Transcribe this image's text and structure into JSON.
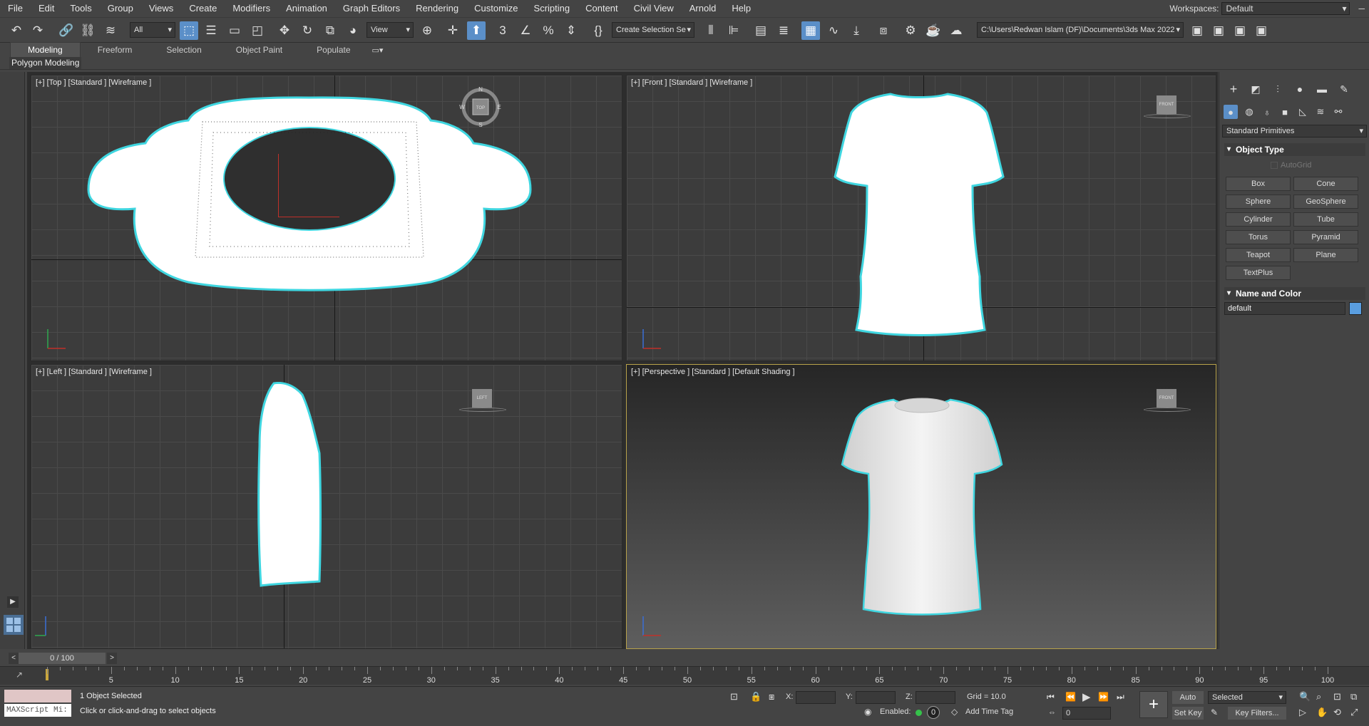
{
  "menu": [
    "File",
    "Edit",
    "Tools",
    "Group",
    "Views",
    "Create",
    "Modifiers",
    "Animation",
    "Graph Editors",
    "Rendering",
    "Customize",
    "Scripting",
    "Content",
    "Civil View",
    "Arnold",
    "Help"
  ],
  "workspace": {
    "label": "Workspaces:",
    "value": "Default"
  },
  "toolbar": {
    "filter_value": "All",
    "view_value": "View",
    "selection_set_value": "Create Selection Se",
    "path_value": "C:\\Users\\Redwan Islam (DF)\\Documents\\3ds Max 2022"
  },
  "ribbon": {
    "tabs": [
      "Modeling",
      "Freeform",
      "Selection",
      "Object Paint",
      "Populate"
    ],
    "active": "Modeling",
    "sub_label": "Polygon Modeling"
  },
  "viewports": {
    "top": {
      "label": "[+] [Top ] [Standard ] [Wireframe ]",
      "cube": "TOP",
      "compass": [
        "N",
        "E",
        "S",
        "W"
      ]
    },
    "front": {
      "label": "[+] [Front ] [Standard ] [Wireframe ]",
      "cube": "FRONT"
    },
    "left": {
      "label": "[+] [Left ] [Standard ] [Wireframe ]",
      "cube": "LEFT"
    },
    "perspective": {
      "label": "[+] [Perspective ] [Standard ] [Default Shading ]",
      "cube": "FRONT"
    }
  },
  "command_panel": {
    "category": "Standard Primitives",
    "object_type_title": "Object Type",
    "autogrid": "AutoGrid",
    "buttons": [
      "Box",
      "Cone",
      "Sphere",
      "GeoSphere",
      "Cylinder",
      "Tube",
      "Torus",
      "Pyramid",
      "Teapot",
      "Plane",
      "TextPlus"
    ],
    "name_color_title": "Name and Color",
    "name_value": "default",
    "object_color": "#5a9ee0"
  },
  "timeline": {
    "frame_display": "0 / 100",
    "ticks": [
      "5",
      "10",
      "15",
      "20",
      "25",
      "30",
      "35",
      "40",
      "45",
      "50",
      "55",
      "60",
      "65",
      "70",
      "75",
      "80",
      "85",
      "90",
      "95",
      "100"
    ]
  },
  "status": {
    "maxscript": "MAXScript Mi:",
    "objects_selected": "1 Object Selected",
    "prompt": "Click or click-and-drag to select objects",
    "x_label": "X:",
    "y_label": "Y:",
    "z_label": "Z:",
    "grid": "Grid = 10.0",
    "enabled_label": "Enabled:",
    "enabled_value": "0",
    "add_time_tag": "Add Time Tag",
    "auto_key": "Auto Key",
    "set_key": "Set Key",
    "key_mode": "Selected",
    "key_filters": "Key Filters...",
    "current_frame": "0"
  },
  "colors": {
    "accent": "#5b8fc8",
    "selection_outline": "#3fd6e0",
    "active_viewport_border": "#b8a24a"
  }
}
